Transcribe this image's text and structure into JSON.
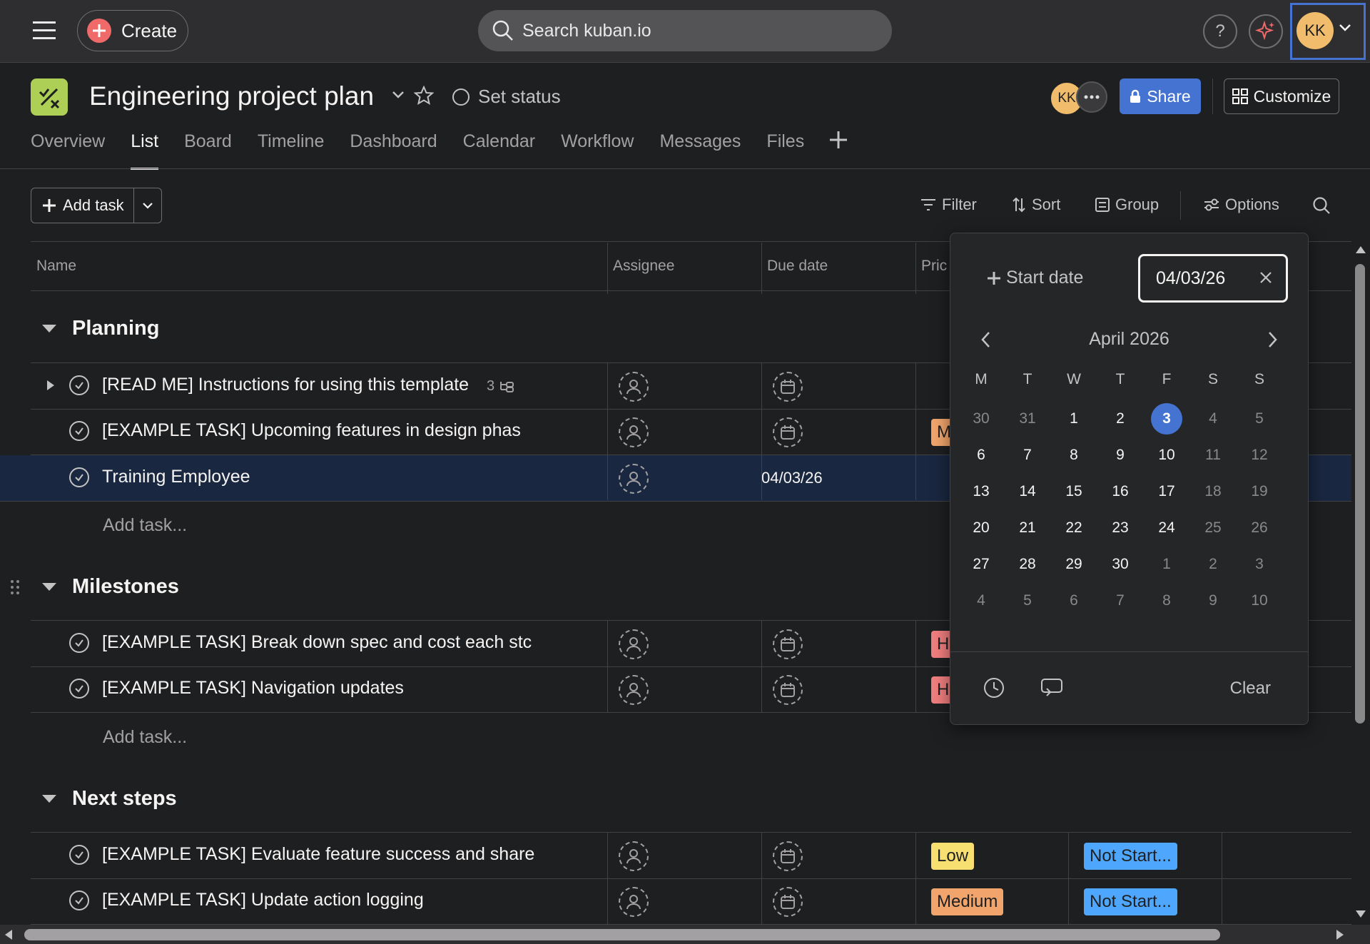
{
  "topbar": {
    "create_label": "Create",
    "search_placeholder": "Search kuban.io",
    "help_label": "?",
    "avatar_initials": "KK"
  },
  "project": {
    "title": "Engineering project plan",
    "set_status_label": "Set status",
    "member_initials": "KK",
    "share_label": "Share",
    "customize_label": "Customize"
  },
  "tabs": [
    {
      "label": "Overview"
    },
    {
      "label": "List"
    },
    {
      "label": "Board"
    },
    {
      "label": "Timeline"
    },
    {
      "label": "Dashboard"
    },
    {
      "label": "Calendar"
    },
    {
      "label": "Workflow"
    },
    {
      "label": "Messages"
    },
    {
      "label": "Files"
    }
  ],
  "active_tab": "List",
  "toolbar": {
    "add_task_label": "Add task",
    "filter_label": "Filter",
    "sort_label": "Sort",
    "group_label": "Group",
    "options_label": "Options"
  },
  "columns": {
    "name": "Name",
    "assignee": "Assignee",
    "due_date": "Due date",
    "priority": "Pric"
  },
  "sections": [
    {
      "title": "Planning",
      "tasks": [
        {
          "name": "[READ ME] Instructions for using this template",
          "subtasks": "3"
        },
        {
          "name": "[EXAMPLE TASK] Upcoming features in design phas",
          "priority": "M"
        },
        {
          "name": "Training Employee",
          "due": "04/03/26"
        }
      ],
      "add_task": "Add task..."
    },
    {
      "title": "Milestones",
      "tasks": [
        {
          "name": "[EXAMPLE TASK] Break down spec and cost each stc",
          "priority": "H"
        },
        {
          "name": "[EXAMPLE TASK] Navigation updates",
          "priority": "H"
        }
      ],
      "add_task": "Add task..."
    },
    {
      "title": "Next steps",
      "tasks": [
        {
          "name": "[EXAMPLE TASK] Evaluate feature success and share",
          "priority": "Low",
          "status": "Not Start..."
        },
        {
          "name": "[EXAMPLE TASK] Update action logging",
          "priority": "Medium",
          "status": "Not Start..."
        }
      ]
    }
  ],
  "datepicker": {
    "start_date_label": "Start date",
    "due_value": "04/03/26",
    "month_label": "April 2026",
    "weekdays": [
      "M",
      "T",
      "W",
      "T",
      "F",
      "S",
      "S"
    ],
    "weeks": [
      [
        "30",
        "31",
        "1",
        "2",
        "3",
        "4",
        "5"
      ],
      [
        "6",
        "7",
        "8",
        "9",
        "10",
        "11",
        "12"
      ],
      [
        "13",
        "14",
        "15",
        "16",
        "17",
        "18",
        "19"
      ],
      [
        "20",
        "21",
        "22",
        "23",
        "24",
        "25",
        "26"
      ],
      [
        "27",
        "28",
        "29",
        "30",
        "1",
        "2",
        "3"
      ],
      [
        "4",
        "5",
        "6",
        "7",
        "8",
        "9",
        "10"
      ]
    ],
    "selected_day": "3",
    "clear_label": "Clear"
  },
  "colors": {
    "accent_blue": "#4573d2",
    "create_red": "#f06a6a",
    "project_icon_green": "#aecf55",
    "avatar_yellow": "#f1bd6c",
    "priority_low": "#f8df72",
    "priority_medium": "#f1a56c",
    "priority_high": "#f07e7e",
    "status_not_started": "#4ea7fc"
  },
  "icons": [
    "hamburger-menu-icon",
    "plus-icon",
    "search-icon",
    "help-icon",
    "sparkle-icon",
    "chevron-down-icon",
    "star-icon",
    "lock-icon",
    "customize-grid-icon",
    "filter-icon",
    "sort-icon",
    "group-icon",
    "options-icon",
    "check-circle-icon",
    "person-icon",
    "calendar-icon",
    "subtask-icon",
    "drag-handle-icon",
    "chevron-left-icon",
    "chevron-right-icon",
    "close-icon",
    "clock-icon",
    "repeat-icon"
  ]
}
